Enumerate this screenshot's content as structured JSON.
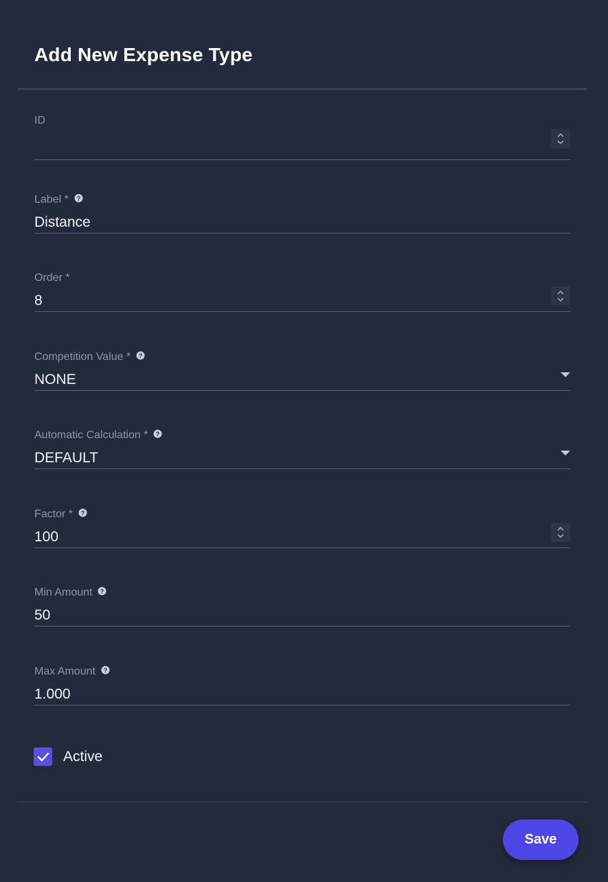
{
  "dialog": {
    "title": "Add New Expense Type"
  },
  "fields": [
    {
      "label": "ID",
      "value": "",
      "type": "number"
    },
    {
      "label": "Label *",
      "value": "Distance",
      "type": "text",
      "help": true
    },
    {
      "label": "Order *",
      "value": "8",
      "type": "number"
    },
    {
      "label": "Competition Value *",
      "value": "NONE",
      "type": "select",
      "help": true
    },
    {
      "label": "Automatic Calculation *",
      "value": "DEFAULT",
      "type": "select",
      "help": true
    },
    {
      "label": "Factor *",
      "value": "100",
      "type": "number",
      "help": true
    },
    {
      "label": "Min Amount",
      "value": "50",
      "type": "text",
      "help": true
    },
    {
      "label": "Max Amount",
      "value": "1.000",
      "type": "text",
      "help": true
    }
  ],
  "active": {
    "label": "Active",
    "checked": true
  },
  "actions": {
    "save_label": "Save"
  },
  "colors": {
    "accent": "#4f46e5",
    "background": "#232a3c"
  },
  "icons": {
    "help": "help-circle-icon",
    "spinner": "chevron-up-down-icon",
    "dropdown": "caret-down-icon",
    "check": "check-icon"
  }
}
